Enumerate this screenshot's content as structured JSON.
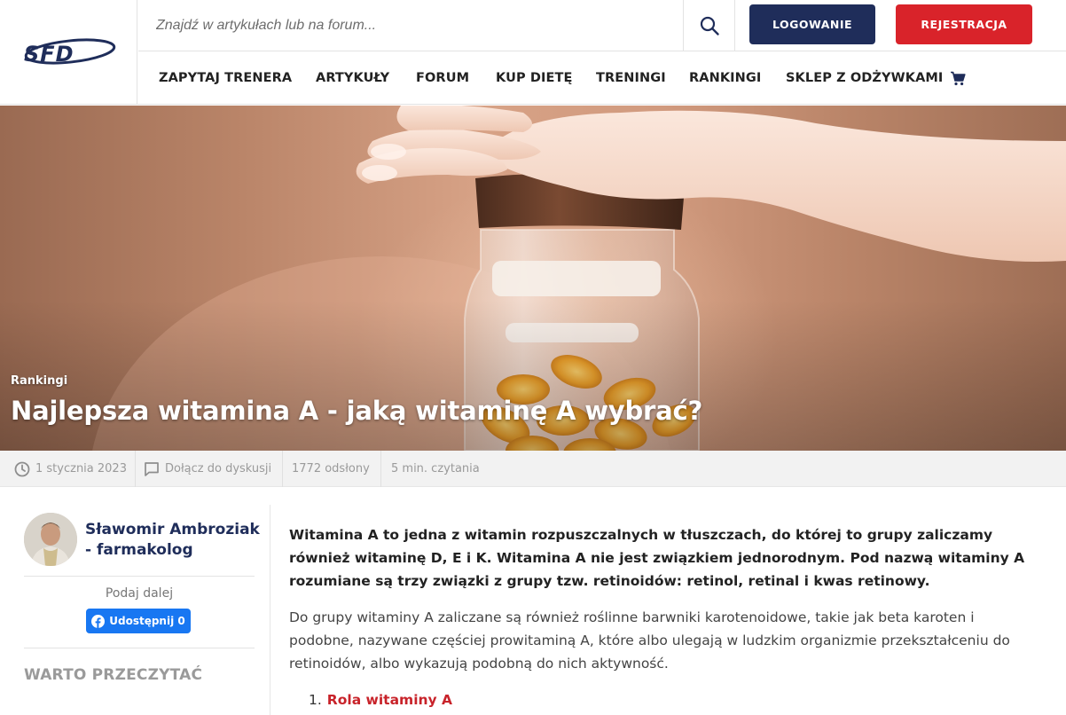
{
  "brand": {
    "logo_text": "SFD",
    "color_navy": "#1f2d5a",
    "color_red": "#d9232a",
    "color_facebook": "#1877f2"
  },
  "search": {
    "placeholder": "Znajdź w artykułach lub na forum...",
    "value": ""
  },
  "auth": {
    "login_label": "LOGOWANIE",
    "register_label": "REJESTRACJA"
  },
  "nav": {
    "items": [
      {
        "label": "ZAPYTAJ TRENERA"
      },
      {
        "label": "ARTYKUŁY"
      },
      {
        "label": "FORUM"
      },
      {
        "label": "KUP DIETĘ"
      },
      {
        "label": "TRENINGI"
      },
      {
        "label": "RANKINGI"
      },
      {
        "label": "SKLEP Z ODŻYWKAMI",
        "icon": "cart-icon"
      }
    ]
  },
  "hero": {
    "category": "Rankingi",
    "title": "Najlepsza witamina A - jaką witaminę A wybrać?"
  },
  "meta": {
    "date": "1 stycznia 2023",
    "discussion": "Dołącz do dyskusji",
    "views": "1772 odsłony",
    "read_time": "5 min. czytania"
  },
  "author": {
    "name_line1": "Sławomir Ambroziak",
    "name_line2": "- farmakolog"
  },
  "share": {
    "label": "Podaj dalej",
    "facebook_label": "Udostępnij 0"
  },
  "sidebar": {
    "recommended_title": "WARTO PRZECZYTAĆ"
  },
  "article": {
    "lead": "Witamina A to jedna z witamin rozpuszczalnych w tłuszczach, do której to grupy zaliczamy również witaminę D, E i K. Witamina A nie jest związkiem jednorodnym. Pod nazwą witaminy A rozumiane są trzy związki z grupy tzw. retinoidów: retinol, retinal i kwas retinowy.",
    "paragraph": "Do grupy witaminy A zaliczane są również roślinne barwniki karotenoidowe, takie jak beta karoten i podobne, nazywane częściej prowitaminą A, które albo ulegają w ludzkim organizmie przekształceniu do retinoidów, albo wykazują podobną do nich aktywność.",
    "toc": [
      {
        "num": "1.",
        "label": "Rola witaminy A"
      }
    ]
  }
}
